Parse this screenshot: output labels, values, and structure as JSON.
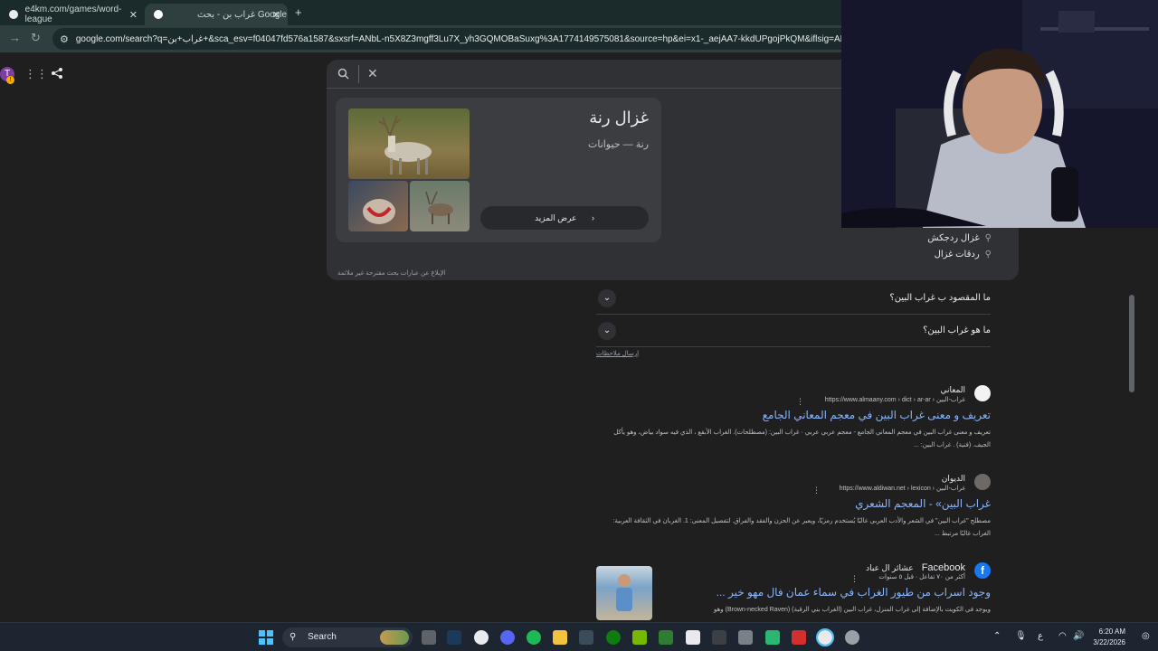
{
  "browser": {
    "tabs": [
      {
        "title": "e4km.com/games/word-league",
        "active": false
      },
      {
        "title": "غراب بن - بحث Google",
        "active": true
      }
    ],
    "new_tab_label": "+",
    "url": "google.com/search?q=غراب+بن+&sca_esv=f04047fd576a1587&sxsrf=ANbL-n5X8Z3mgff3Lu7X_yh3GQMOBaSuxg%3A1774149575081&source=hp&ei=x1-_aejAA7-kkdUPgojPkQM&iflsig=AFdpzrgAAAAab"
  },
  "knowledge_card": {
    "title": "غزال رنة",
    "subtitle": "رنة — حيوانات",
    "more_label": "عرض المزيد"
  },
  "suggestions": [
    "غزال ردجكش",
    "ردقات غزال"
  ],
  "report_text": "الإبلاغ عن عبارات بحث مقترحة غير ملائمة",
  "faqs": [
    "ما المقصود ب غراب البين؟",
    "ما هو غراب البين؟"
  ],
  "feedback_label": "إرسال ملاحظات",
  "results": [
    {
      "site": "المعاني",
      "url": "https://www.almaany.com › dict › ar-ar › غراب-البين",
      "title": "تعريف و معنى غراب البين في معجم المعاني الجامع",
      "snippet": "تعريف و معنى غراب البين في معجم المعاني الجامع - معجم عربي عربي · غراب البين: (مصطلحات). الغراب الأبقع ، الذي فيه سواد بياض، وهو يأكل الجيف. (فنية) . غراب البين: ..."
    },
    {
      "site": "الديوان",
      "url": "https://www.aldiwan.net › lexicon › غراب-البين",
      "title": "غراب البين» - المعجم الشعري",
      "snippet": "مصطلح \"غراب البين\" في الشعر والأدب العربي غالبًا يُستخدم رمزيًا، ويعبر عن الحزن والفقد والفراق. لتفصيل المعنى: 1. الغربان في الثقافة العربية: الغراب غالبًا مرتبط ..."
    },
    {
      "site": "Facebook",
      "site_extra": "عشائر ال عباد",
      "url": "أكثر من ٧٠ تفاعل · قبل ٥ سنوات",
      "title": "وجود اسراب من طيور الغراب في سماء عمان فال مهو خير ...",
      "snippet": "ويوجد في الكويت بالإضافة إلى غراب المنزل، غراب البين (الغراب بني الرقبة) (Brown-necked Raven) وهو"
    }
  ],
  "taskbar": {
    "search_label": "Search",
    "clock_time": "6:20 AM",
    "clock_date": "3/22/2026",
    "lang": "ع"
  },
  "colors": {
    "link": "#8ab4f8",
    "background": "#1f1f1f",
    "facebook": "#1877f2"
  }
}
